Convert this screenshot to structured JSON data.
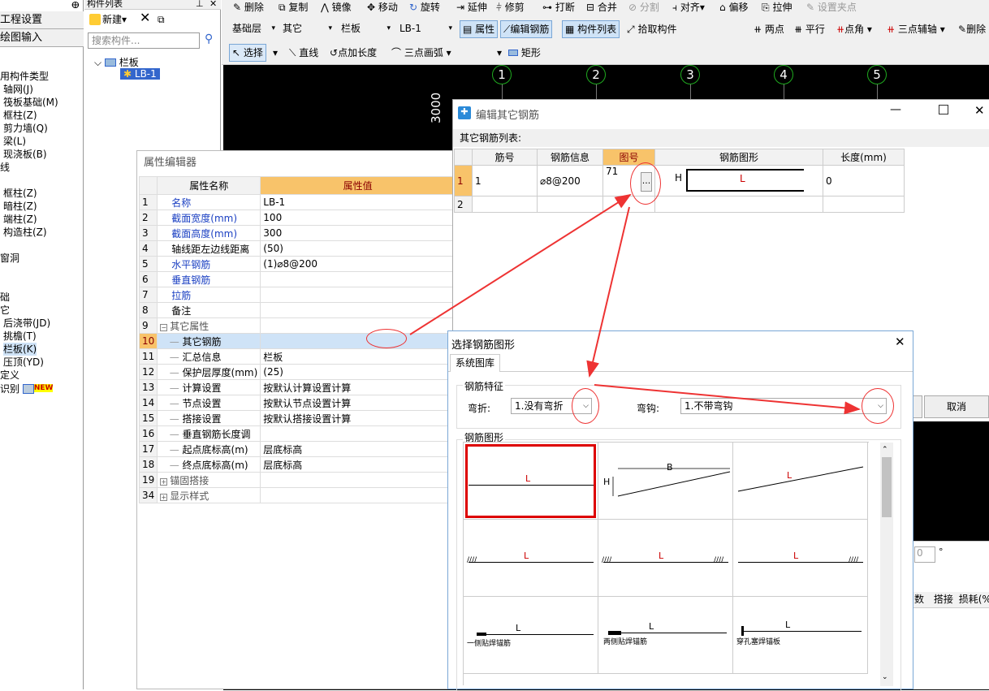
{
  "left_panel": {
    "header1": "工程设置",
    "header2": "绘图输入",
    "items": [
      "用构件类型",
      "轴网(J)",
      "筏板基础(M)",
      "框柱(Z)",
      "剪力墙(Q)",
      "梁(L)",
      "现浇板(B)",
      "线",
      "框柱(Z)",
      "暗柱(Z)",
      "端柱(Z)",
      "构造柱(Z)",
      "窗洞",
      "础",
      "它",
      "后浇带(JD)",
      "挑檐(T)",
      "栏板(K)",
      "压顶(YD)",
      "定义",
      "识别"
    ],
    "new_badge": "NEW"
  },
  "comp_panel": {
    "title": "构件列表",
    "new_label": "新建",
    "search_placeholder": "搜索构件...",
    "tree_root": "栏板",
    "tree_leaf": "LB-1"
  },
  "toolbar1": [
    "删除",
    "复制",
    "镜像",
    "移动",
    "旋转",
    "延伸",
    "修剪",
    "打断",
    "合并",
    "分割",
    "对齐",
    "偏移",
    "拉伸",
    "设置夹点"
  ],
  "toolbar2": {
    "floor": "基础层",
    "type1": "其它",
    "type2": "栏板",
    "comp": "LB-1",
    "btn_attr": "属性",
    "btn_edit": "编辑钢筋",
    "btn_list": "构件列表",
    "btn_pick": "拾取构件",
    "tools": [
      "两点",
      "平行",
      "点角",
      "三点辅轴",
      "删除"
    ]
  },
  "toolbar3": {
    "select": "选择",
    "line": "直线",
    "point_len": "点加长度",
    "arc": "三点画弧",
    "rect": "矩形"
  },
  "cad": {
    "axes": [
      "1",
      "2",
      "3",
      "4",
      "5"
    ],
    "dim": "3000"
  },
  "prop_editor": {
    "title": "属性编辑器",
    "col_name": "属性名称",
    "col_value": "属性值",
    "rows": [
      {
        "n": "1",
        "name": "名称",
        "value": "LB-1"
      },
      {
        "n": "2",
        "name": "截面宽度(mm)",
        "value": "100"
      },
      {
        "n": "3",
        "name": "截面高度(mm)",
        "value": "300"
      },
      {
        "n": "4",
        "name": "轴线距左边线距离",
        "value": "(50)"
      },
      {
        "n": "5",
        "name": "水平钢筋",
        "value": "(1)⌀8@200"
      },
      {
        "n": "6",
        "name": "垂直钢筋",
        "value": ""
      },
      {
        "n": "7",
        "name": "拉筋",
        "value": ""
      },
      {
        "n": "8",
        "name": "备注",
        "value": ""
      },
      {
        "n": "9",
        "name": "其它属性",
        "value": ""
      },
      {
        "n": "10",
        "name": "其它钢筋",
        "value": ""
      },
      {
        "n": "11",
        "name": "汇总信息",
        "value": "栏板"
      },
      {
        "n": "12",
        "name": "保护层厚度(mm)",
        "value": "(25)"
      },
      {
        "n": "13",
        "name": "计算设置",
        "value": "按默认计算设置计算"
      },
      {
        "n": "14",
        "name": "节点设置",
        "value": "按默认节点设置计算"
      },
      {
        "n": "15",
        "name": "搭接设置",
        "value": "按默认搭接设置计算"
      },
      {
        "n": "16",
        "name": "垂直钢筋长度调",
        "value": ""
      },
      {
        "n": "17",
        "name": "起点底标高(m)",
        "value": "层底标高"
      },
      {
        "n": "18",
        "name": "终点底标高(m)",
        "value": "层底标高"
      },
      {
        "n": "19",
        "name": "锚固搭接",
        "value": ""
      },
      {
        "n": "34",
        "name": "显示样式",
        "value": ""
      }
    ]
  },
  "rebar_dialog": {
    "title": "编辑其它钢筋",
    "list_label": "其它钢筋列表:",
    "cols": [
      "筋号",
      "钢筋信息",
      "图号",
      "钢筋图形",
      "长度(mm)"
    ],
    "row1": {
      "n": "1",
      "no": "1",
      "info": "⌀8@200",
      "fig": "71",
      "len": "0",
      "h": "H",
      "l": "L"
    },
    "row2_n": "2",
    "ellipsis": "...",
    "cancel": "取消"
  },
  "bottom_panel": {
    "cols": [
      "数",
      "搭接",
      "损耗(%"
    ],
    "deg": "°",
    "zero": "0"
  },
  "shape_dialog": {
    "title": "选择钢筋图形",
    "tab": "系统图库",
    "feature_label": "钢筋特征",
    "bend_label": "弯折:",
    "bend_value": "1.没有弯折",
    "hook_label": "弯钩:",
    "hook_value": "1.不带弯钩",
    "shape_label": "钢筋图形",
    "cells": [
      {
        "l": "L"
      },
      {
        "l": "B",
        "h": "H"
      },
      {
        "l": "L"
      },
      {
        "l": "L"
      },
      {
        "l": "L"
      },
      {
        "l": "L"
      },
      {
        "l": "L",
        "cap": "一侧贴焊锚筋"
      },
      {
        "l": "L",
        "cap": "两侧贴焊锚筋"
      },
      {
        "l": "L",
        "cap": "穿孔塞焊锚板"
      }
    ]
  },
  "colors": {
    "accent": "#cfe3f7",
    "highlight": "#f8c36a",
    "annot": "#e33333",
    "cad_bg": "#000000"
  }
}
